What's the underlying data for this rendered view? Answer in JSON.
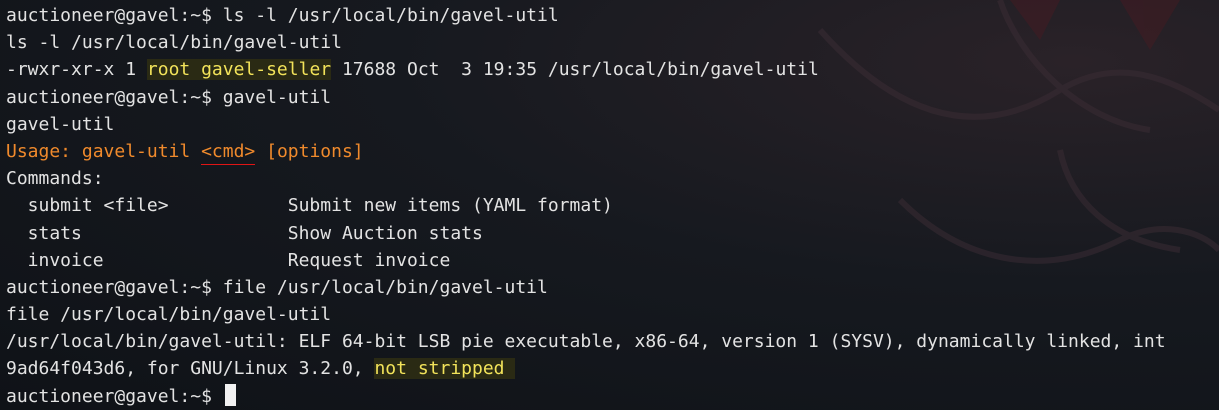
{
  "terminal": {
    "prompt": "auctioneer@gavel:~$",
    "lines": [
      {
        "segments": [
          {
            "text": "auctioneer@gavel:~$ ls -l /usr/local/bin/gavel-util",
            "style": "plain"
          }
        ]
      },
      {
        "segments": [
          {
            "text": "ls -l /usr/local/bin/gavel-util",
            "style": "plain"
          }
        ]
      },
      {
        "segments": [
          {
            "text": "-rwxr-xr-x 1 ",
            "style": "plain"
          },
          {
            "text": "root gavel-seller",
            "style": "hl"
          },
          {
            "text": " 17688 Oct  3 19:35 /usr/local/bin/gavel-util",
            "style": "plain"
          }
        ]
      },
      {
        "segments": [
          {
            "text": "auctioneer@gavel:~$ gavel-util",
            "style": "plain"
          }
        ]
      },
      {
        "segments": [
          {
            "text": "gavel-util",
            "style": "plain"
          }
        ]
      },
      {
        "segments": [
          {
            "text": "Usage: gavel-util ",
            "style": "orange"
          },
          {
            "text": "<cmd>",
            "style": "orange-underline"
          },
          {
            "text": " [options]",
            "style": "orange"
          }
        ]
      },
      {
        "segments": [
          {
            "text": "Commands:",
            "style": "plain"
          }
        ]
      },
      {
        "segments": [
          {
            "text": "  submit <file>           Submit new items (YAML format)",
            "style": "plain"
          }
        ]
      },
      {
        "segments": [
          {
            "text": "  stats                   Show Auction stats",
            "style": "plain"
          }
        ]
      },
      {
        "segments": [
          {
            "text": "  invoice                 Request invoice",
            "style": "plain"
          }
        ]
      },
      {
        "segments": [
          {
            "text": "auctioneer@gavel:~$ file /usr/local/bin/gavel-util",
            "style": "plain"
          }
        ]
      },
      {
        "segments": [
          {
            "text": "file /usr/local/bin/gavel-util",
            "style": "plain"
          }
        ]
      },
      {
        "segments": [
          {
            "text": "/usr/local/bin/gavel-util: ELF 64-bit LSB pie executable, x86-64, version 1 (SYSV), dynamically linked, int",
            "style": "plain"
          }
        ]
      },
      {
        "segments": [
          {
            "text": "9ad64f043d6, for GNU/Linux 3.2.0, ",
            "style": "plain"
          },
          {
            "text": "not stripped ",
            "style": "hl"
          }
        ]
      },
      {
        "segments": [
          {
            "text": "auctioneer@gavel:~$ ",
            "style": "plain"
          }
        ],
        "cursor": true
      }
    ]
  },
  "colors": {
    "background": "#12151c",
    "text": "#e3e3e3",
    "usage_orange": "#f08a2c",
    "highlight_yellow": "#f2e35a",
    "annotation_red": "#e01515"
  },
  "icons": [
    "terminal-cursor"
  ]
}
